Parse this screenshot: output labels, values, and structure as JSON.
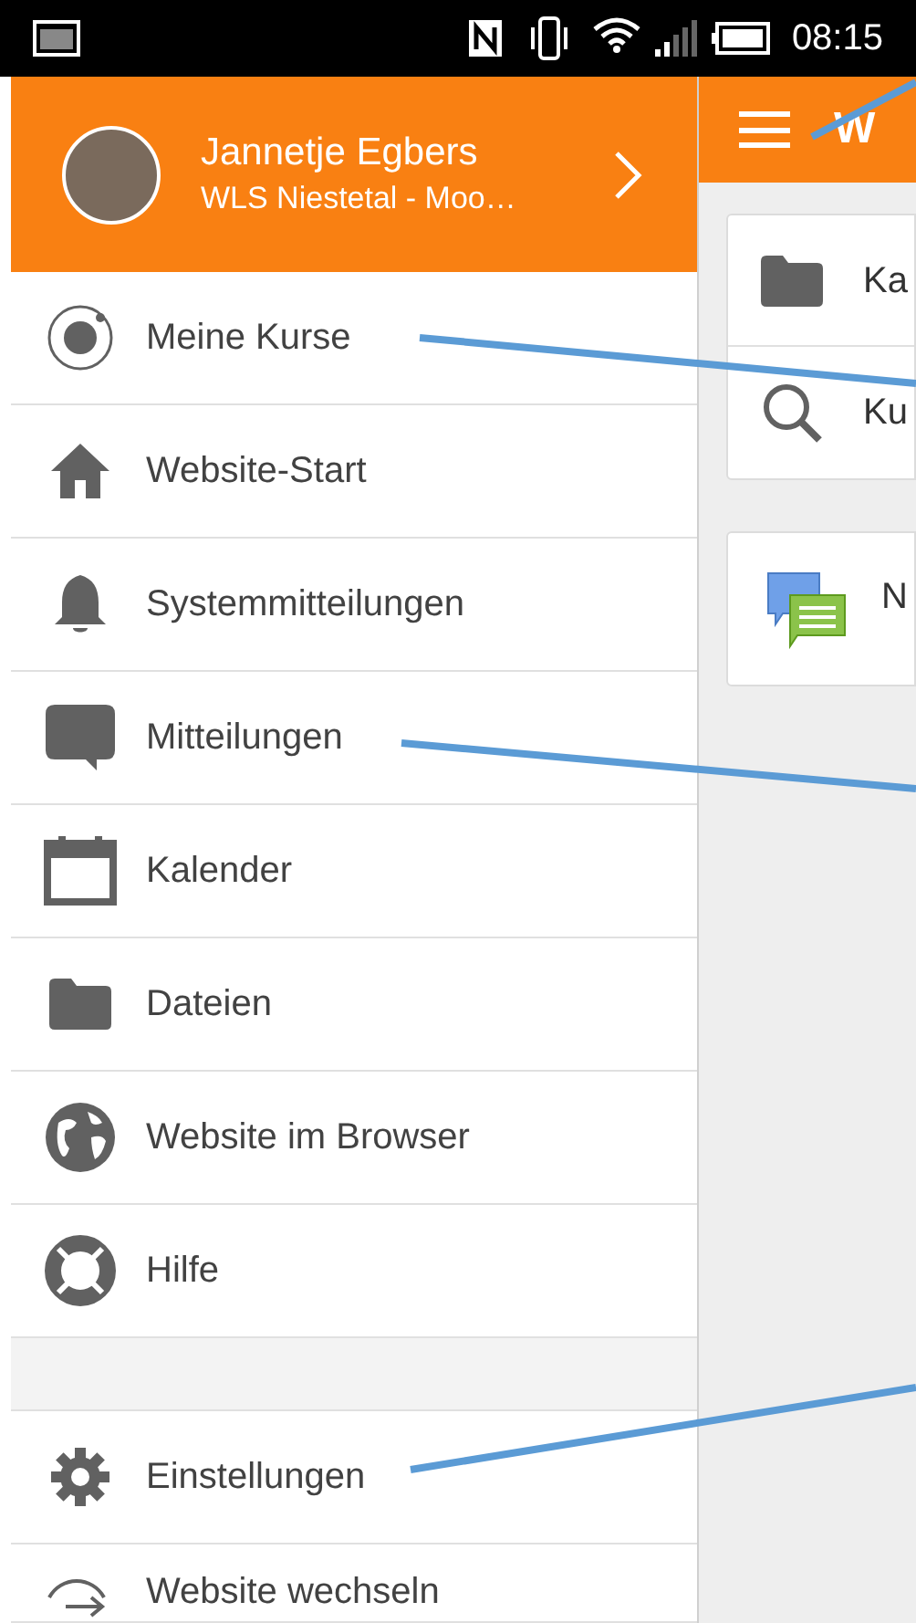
{
  "status_bar": {
    "time": "08:15"
  },
  "drawer": {
    "user": {
      "name": "Jannetje Egbers",
      "site": "WLS Niestetal - Moo…"
    },
    "items": [
      {
        "label": "Meine Kurse"
      },
      {
        "label": "Website-Start"
      },
      {
        "label": "Systemmitteilungen"
      },
      {
        "label": "Mitteilungen"
      },
      {
        "label": "Kalender"
      },
      {
        "label": "Dateien"
      },
      {
        "label": "Website im Browser"
      },
      {
        "label": "Hilfe"
      },
      {
        "kind": "spacer"
      },
      {
        "label": "Einstellungen"
      },
      {
        "label": "Website wechseln"
      }
    ]
  },
  "main": {
    "app_bar": {
      "title": "W"
    },
    "card_rows": [
      {
        "label": "Ka"
      },
      {
        "label": "Ku"
      }
    ],
    "card2": {
      "label": "N"
    }
  }
}
